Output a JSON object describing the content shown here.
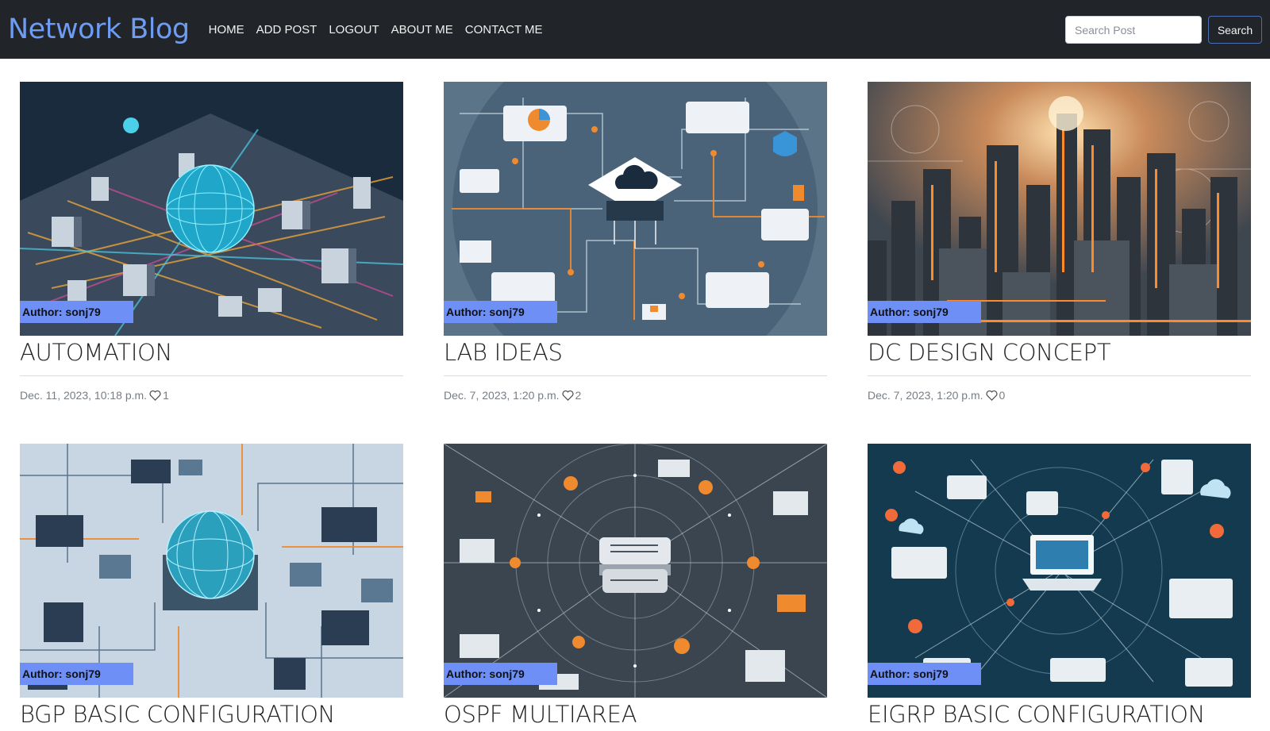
{
  "brand": "Network Blog",
  "nav": {
    "home": "HOME",
    "add_post": "ADD POST",
    "logout": "LOGOUT",
    "about": "ABOUT ME",
    "contact": "CONTACT ME"
  },
  "search": {
    "placeholder": "Search Post",
    "button": "Search"
  },
  "posts": [
    {
      "title": "AUTOMATION",
      "author": "Author: sonj79",
      "date": "Dec. 11, 2023, 10:18 p.m.",
      "likes": "1",
      "image": "isometric-network-globe-city"
    },
    {
      "title": "LAB IDEAS",
      "author": "Author: sonj79",
      "date": "Dec. 7, 2023, 1:20 p.m.",
      "likes": "2",
      "image": "cloud-network-diagram"
    },
    {
      "title": "DC DESIGN CONCEPT",
      "author": "Author: sonj79",
      "date": "Dec. 7, 2023, 1:20 p.m.",
      "likes": "0",
      "image": "futuristic-data-center-city"
    },
    {
      "title": "BGP BASIC CONFIGURATION",
      "author": "Author: sonj79",
      "image": "isometric-network-globe-light"
    },
    {
      "title": "OSPF MULTIAREA",
      "author": "Author: sonj79",
      "image": "central-router-network"
    },
    {
      "title": "EIGRP BASIC CONFIGURATION",
      "author": "Author: sonj79",
      "image": "laptops-network-map"
    }
  ],
  "colors": {
    "navbar_bg": "#212529",
    "brand": "#6e9cf2",
    "author_badge": "#6e8ff5",
    "accent_orange": "#f08a2e"
  },
  "icons": {
    "likes": "heart-icon"
  }
}
